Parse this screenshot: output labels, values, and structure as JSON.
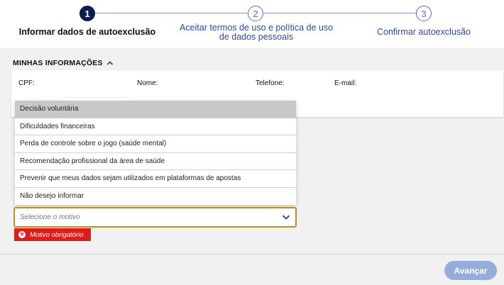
{
  "stepper": {
    "steps": [
      {
        "number": "1",
        "label": "Informar dados de autoexclusão",
        "state": "active"
      },
      {
        "number": "2",
        "label": "Aceitar termos de uso e política de uso de dados pessoais",
        "state": "inactive"
      },
      {
        "number": "3",
        "label": "Confirmar autoexclusão",
        "state": "inactive"
      }
    ]
  },
  "section": {
    "title": "MINHAS INFORMAÇÕES",
    "toggle_icon": "chevron-up-icon"
  },
  "info": {
    "fields": [
      {
        "label": "CPF:"
      },
      {
        "label": "Nome:"
      },
      {
        "label": "Telefone:"
      },
      {
        "label": "E-mail:"
      }
    ]
  },
  "reason": {
    "options": [
      "Decisão voluntária",
      "Dificuldades financeiras",
      "Perda de controle sobre o jogo (saúde mental)",
      "Recomendação profissional da área de saúde",
      "Prevenir que meus dados sejam utilizados em plataformas de apostas",
      "Não desejo informar"
    ],
    "highlighted_index": 0,
    "placeholder": "Selecione o motivo",
    "error": "Motivo obrigatório"
  },
  "actions": {
    "next_label": "Avançar"
  },
  "colors": {
    "primary": "#0e1a52",
    "step_inactive": "#5a6fb2",
    "error": "#dd1d1d",
    "focus_border": "#c98a1c",
    "button": "#96acdb"
  }
}
